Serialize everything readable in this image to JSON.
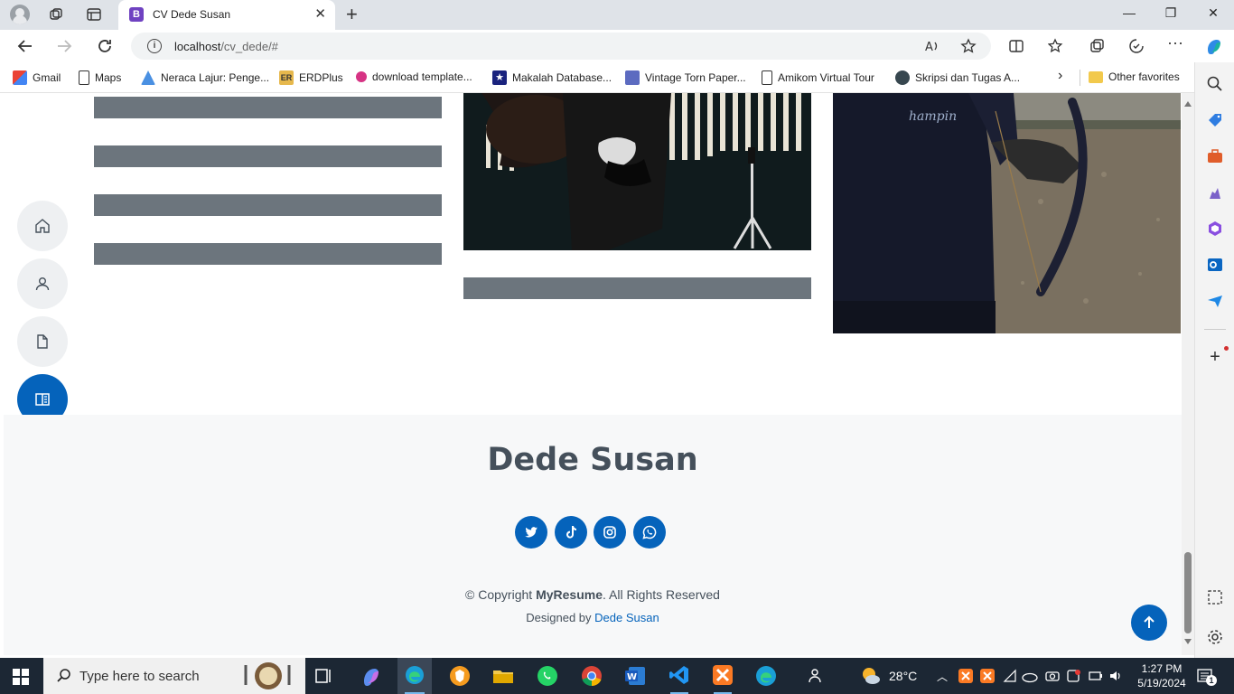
{
  "browser": {
    "tab_title": "CV Dede Susan",
    "tab_favicon_letter": "B",
    "url_host": "localhost",
    "url_path": "/cv_dede/#"
  },
  "bookmarks": [
    {
      "label": "Gmail",
      "icon": "gmail-icon",
      "color": "#ea4335"
    },
    {
      "label": "Maps",
      "icon": "page-icon",
      "color": "#ffffff"
    },
    {
      "label": "Neraca Lajur: Penge...",
      "icon": "app-icon",
      "color": "#4a90e2"
    },
    {
      "label": "ERDPlus",
      "icon": "er-icon",
      "color": "#e6b84d"
    },
    {
      "label": "download template...",
      "icon": "dot-icon",
      "color": "#d63384"
    },
    {
      "label": "Makalah Database...",
      "icon": "star-badge-icon",
      "color": "#1a237e"
    },
    {
      "label": "Vintage Torn Paper...",
      "icon": "picture-icon",
      "color": "#5c6bc0"
    },
    {
      "label": "Amikom Virtual Tour",
      "icon": "page-icon",
      "color": "#ffffff"
    },
    {
      "label": "Skripsi dan Tugas A...",
      "icon": "bird-icon",
      "color": "#37474f"
    }
  ],
  "bookmarks_other": "Other favorites",
  "side_nav": [
    {
      "name": "home-nav-button",
      "icon": "home-icon",
      "active": false
    },
    {
      "name": "about-nav-button",
      "icon": "person-icon",
      "active": false
    },
    {
      "name": "resume-nav-button",
      "icon": "file-icon",
      "active": false
    },
    {
      "name": "portfolio-nav-button",
      "icon": "book-half-icon",
      "active": true
    },
    {
      "name": "services-nav-button",
      "icon": "server-icon",
      "active": false
    },
    {
      "name": "contact-nav-button",
      "icon": "envelope-icon",
      "active": false
    }
  ],
  "footer": {
    "name": "Dede Susan",
    "social": [
      "twitter-icon",
      "tiktok-icon",
      "instagram-icon",
      "whatsapp-icon"
    ],
    "copyright_prefix": "© Copyright",
    "copyright_brand": "MyResume",
    "copyright_suffix": ". All Rights Reserved",
    "designed_by": "Designed by",
    "designer": "Dede Susan"
  },
  "colors": {
    "accent": "#0563bb",
    "bar_gray": "#6c757d",
    "heading": "#45505b"
  },
  "taskbar": {
    "search_placeholder": "Type here to search",
    "weather": "28°C",
    "time": "1:27 PM",
    "date": "5/19/2024",
    "notifications": "1"
  }
}
